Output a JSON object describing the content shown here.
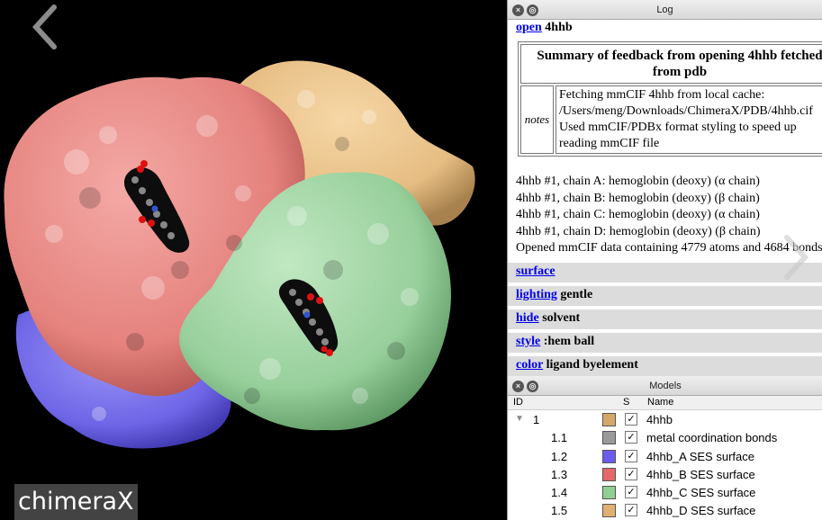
{
  "viewer": {
    "watermark": "chimeraX",
    "colors": {
      "chain_a": "#e58a86",
      "chain_b": "#eec88f",
      "chain_c": "#9dd5a0",
      "chain_d": "#7770e8"
    }
  },
  "log": {
    "title": "Log",
    "first_command": {
      "link": "open",
      "arg": "4hhb"
    },
    "summary_title": "Summary of feedback from opening 4hhb fetched from pdb",
    "notes_label": "notes",
    "notes_lines": [
      "Fetching mmCIF 4hhb from local cache:",
      "/Users/meng/Downloads/ChimeraX/PDB/4hhb.cif",
      "Used mmCIF/PDBx format styling to speed up",
      "reading mmCIF file"
    ],
    "info_lines": [
      "4hhb #1, chain A: hemoglobin (deoxy) (α chain)",
      "4hhb #1, chain B: hemoglobin (deoxy) (β chain)",
      "4hhb #1, chain C: hemoglobin (deoxy) (α chain)",
      "4hhb #1, chain D: hemoglobin (deoxy) (β chain)",
      "Opened mmCIF data containing 4779 atoms and 4684 bonds"
    ],
    "commands": [
      {
        "link": "surface",
        "arg": ""
      },
      {
        "link": "lighting",
        "arg": "gentle"
      },
      {
        "link": "hide",
        "arg": "solvent"
      },
      {
        "link": "style",
        "arg": ":hem ball"
      },
      {
        "link": "color",
        "arg": "ligand byelement"
      }
    ]
  },
  "models": {
    "title": "Models",
    "headers": {
      "id": "ID",
      "shown": "S",
      "name": "Name"
    },
    "rows": [
      {
        "id": "1",
        "name": "4hhb",
        "color": "#d4a86a",
        "checked": "✓",
        "expander": "▼"
      },
      {
        "id": "1.1",
        "name": "metal coordination bonds",
        "color": "#9a9a9a",
        "checked": "✓",
        "expander": ""
      },
      {
        "id": "1.2",
        "name": "4hhb_A SES surface",
        "color": "#6b5cf0",
        "checked": "✓",
        "expander": ""
      },
      {
        "id": "1.3",
        "name": "4hhb_B SES surface",
        "color": "#e56767",
        "checked": "✓",
        "expander": ""
      },
      {
        "id": "1.4",
        "name": "4hhb_C SES surface",
        "color": "#8fcf8f",
        "checked": "✓",
        "expander": ""
      },
      {
        "id": "1.5",
        "name": "4hhb_D SES surface",
        "color": "#e0b070",
        "checked": "✓",
        "expander": ""
      }
    ]
  }
}
